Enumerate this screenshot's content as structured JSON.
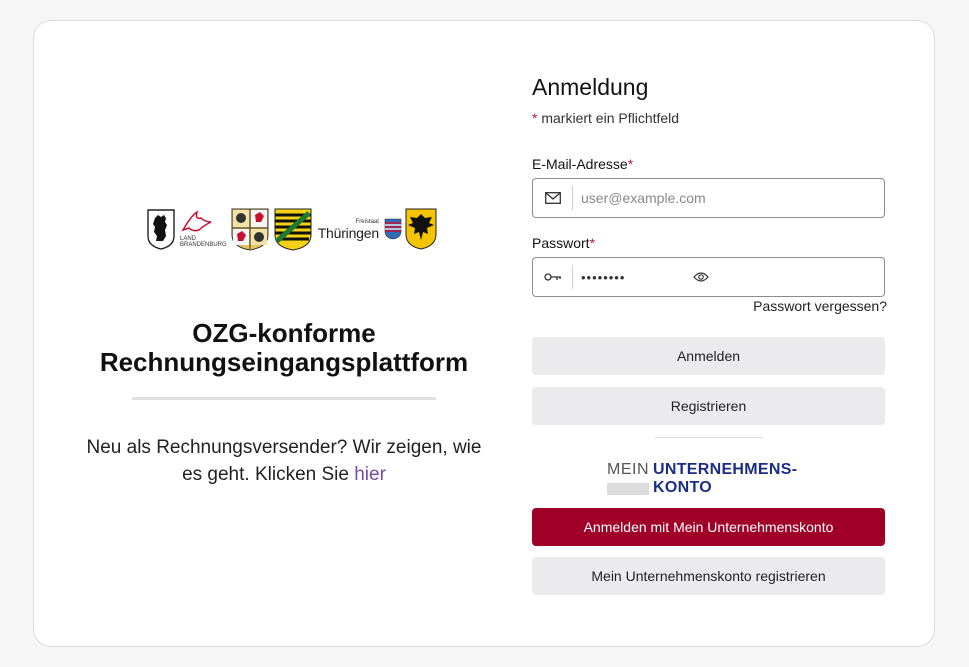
{
  "left": {
    "logos": {
      "brandenburg_text": "LAND BRANDENBURG",
      "thueringen_small": "Freistaat",
      "thueringen_big": "Thüringen"
    },
    "title_line1": "OZG-konforme",
    "title_line2": "Rechnungseingangsplattform",
    "intro_text": "Neu als Rechnungsversender? Wir zeigen, wie es geht. Klicken Sie ",
    "intro_link": "hier"
  },
  "login": {
    "title": "Anmeldung",
    "required_star": "*",
    "required_note": "markiert ein Pflichtfeld",
    "email_label": "E-Mail-Adresse",
    "email_placeholder": "user@example.com",
    "password_label": "Passwort",
    "password_value": "••••••••",
    "forgot_password": "Passwort vergessen?",
    "login_button": "Anmelden",
    "register_button": "Registrieren"
  },
  "unternehmenskonto": {
    "logo_mein": "MEIN",
    "logo_line1": "UNTERNEHMENS-",
    "logo_line2": "KONTO",
    "login_button": "Anmelden mit Mein Unternehmenskonto",
    "register_button": "Mein Unternehmenskonto registrieren"
  },
  "colors": {
    "accent": "#a00028",
    "required": "#b31b34",
    "link": "#7b4a9e",
    "muk_blue": "#1c2d86",
    "button_grey": "#ebebed"
  },
  "icons": {
    "email": "envelope-icon",
    "password": "key-icon",
    "show_password": "eye-icon"
  }
}
